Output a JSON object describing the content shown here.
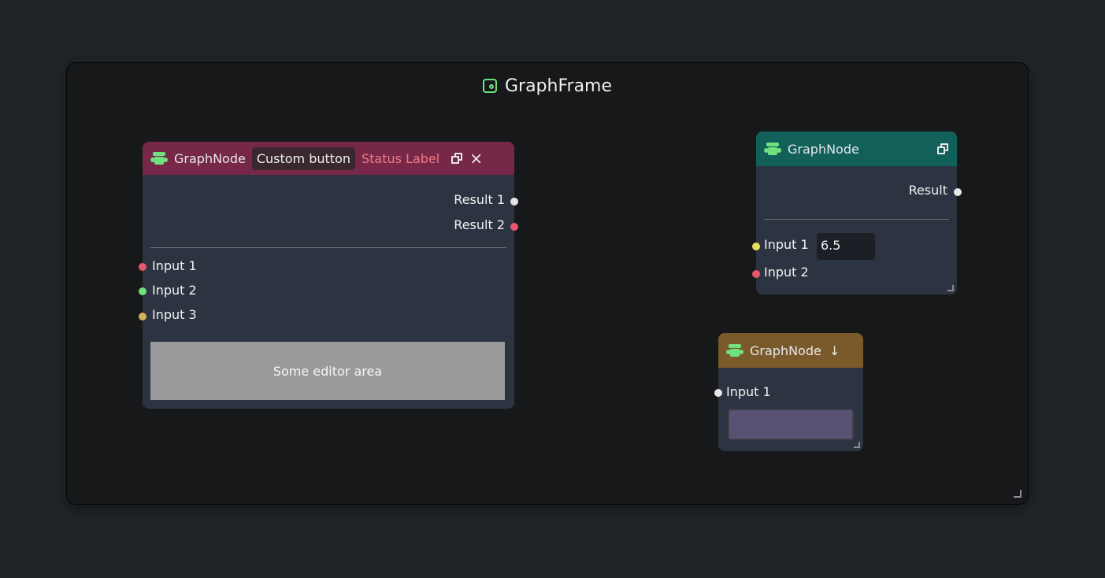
{
  "frame": {
    "title": "GraphFrame",
    "icon": "graph-frame-icon"
  },
  "node_left": {
    "title": "GraphNode",
    "custom_button": "Custom button",
    "status_label": "Status Label",
    "header_color": "#772848",
    "outputs": [
      "Result 1",
      "Result 2"
    ],
    "inputs": [
      "Input 1",
      "Input 2",
      "Input 3"
    ],
    "editor_area": "Some editor area",
    "port_colors": {
      "result_1": "#e6e6e6",
      "result_2": "#e8566c",
      "input_1": "#e8566c",
      "input_2": "#6fe27f",
      "input_3": "#d7b25c"
    }
  },
  "node_right": {
    "title": "GraphNode",
    "header_color": "#12605a",
    "output": "Result",
    "inputs": [
      "Input 1",
      "Input 2"
    ],
    "input_1_value": "6.5",
    "port_colors": {
      "result": "#e6e6e6",
      "input_1": "#e8e05a",
      "input_2": "#e8566c"
    }
  },
  "node_bottom": {
    "title": "GraphNode",
    "header_color": "#7a5a2b",
    "input": "Input 1",
    "color_value": "#5a5275",
    "port_colors": {
      "input_1": "#e6e6e6"
    }
  }
}
